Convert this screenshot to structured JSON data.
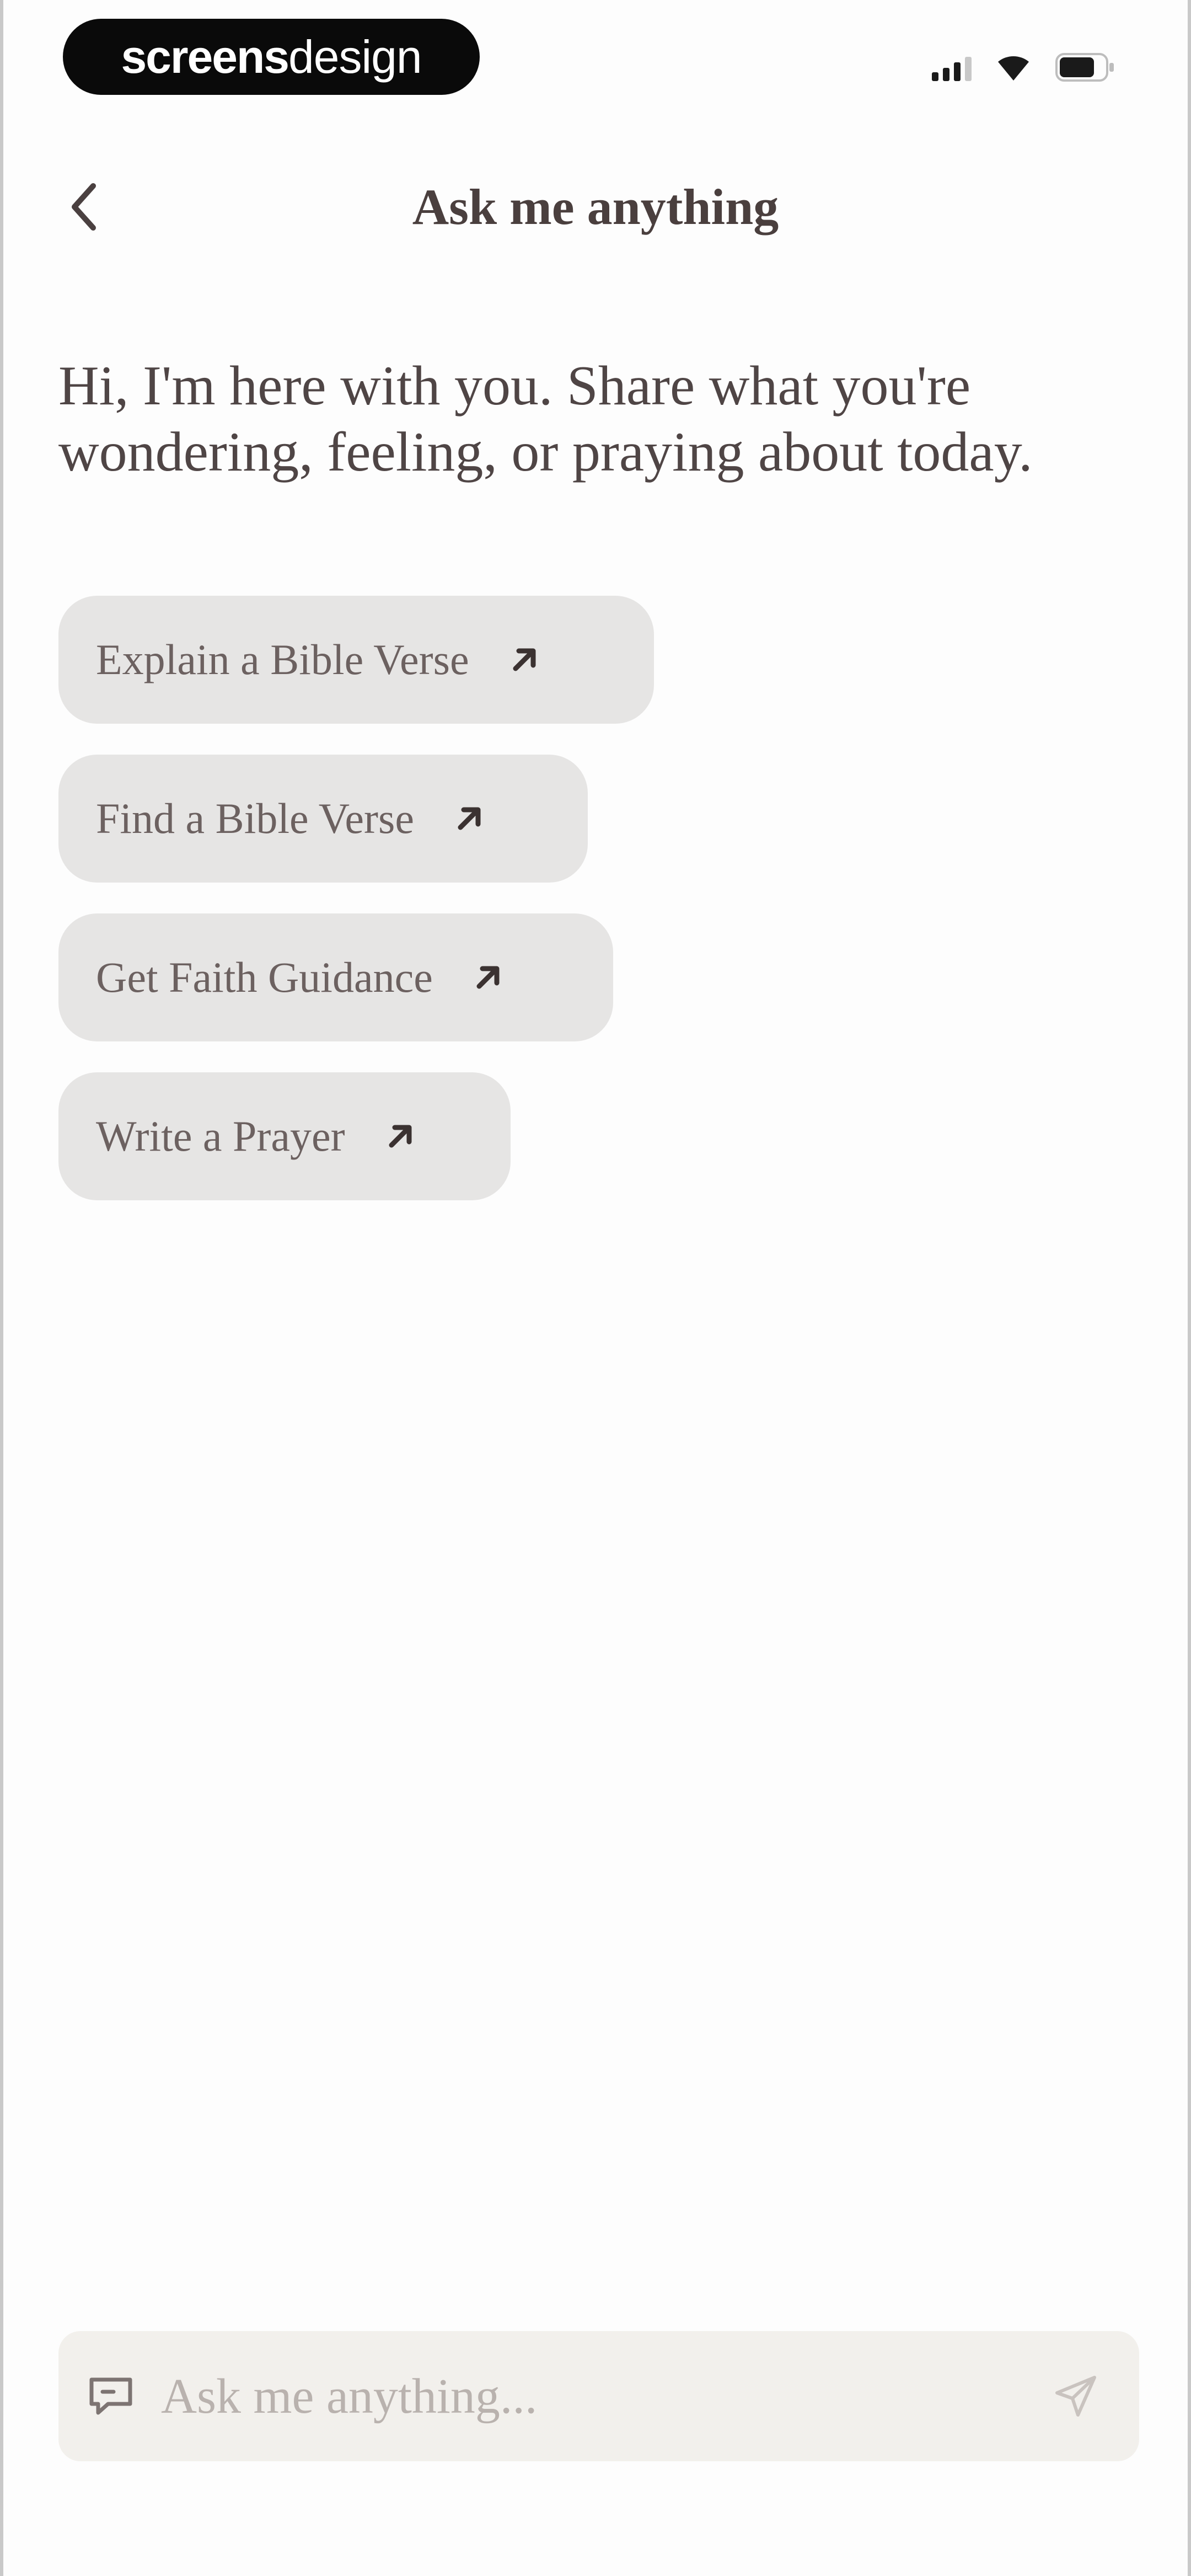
{
  "status_bar": {
    "brand": {
      "strong": "screens",
      "light": "design"
    },
    "icons": [
      "signal-icon",
      "wifi-icon",
      "battery-icon"
    ]
  },
  "header": {
    "title": "Ask me anything",
    "back_icon": "chevron-left-icon"
  },
  "greeting": "Hi, I'm here with you. Share what you're wondering, feeling, or praying about today.",
  "suggestions": [
    {
      "label": "Explain a Bible Verse",
      "icon": "arrow-up-right-icon"
    },
    {
      "label": "Find a Bible Verse",
      "icon": "arrow-up-right-icon"
    },
    {
      "label": "Get Faith Guidance",
      "icon": "arrow-up-right-icon"
    },
    {
      "label": "Write a Prayer",
      "icon": "arrow-up-right-icon"
    }
  ],
  "input": {
    "placeholder": "Ask me anything...",
    "value": "",
    "leading_icon": "chat-bubble-icon",
    "send_icon": "send-icon"
  },
  "colors": {
    "background": "#fdfdfd",
    "text": "#4f4545",
    "chip_bg": "#e6e5e4",
    "chip_text": "#6c6160",
    "input_bg": "#f2f0ec",
    "placeholder": "#b9b2ae"
  }
}
